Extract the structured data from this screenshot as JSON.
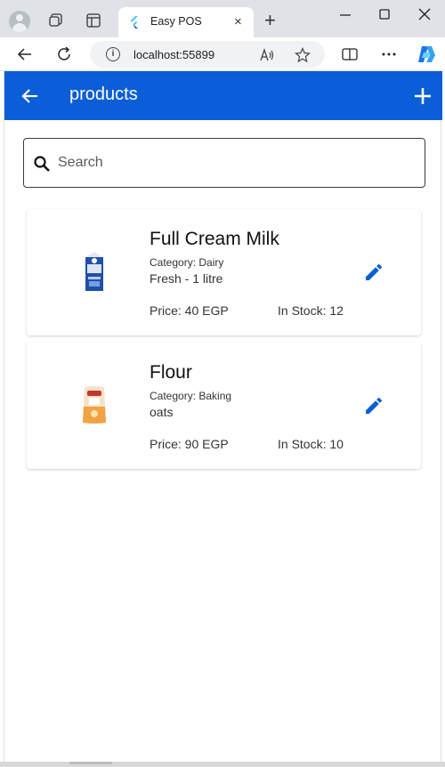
{
  "browser": {
    "tab_title": "Easy POS",
    "tab_close": "×",
    "new_tab": "+",
    "url": "localhost:55899",
    "info_glyph": "i"
  },
  "appbar": {
    "title": "products",
    "back_icon": "arrow-back-icon",
    "add_icon": "add-icon",
    "color": "#0b5ed7"
  },
  "search": {
    "placeholder": "Search",
    "value": ""
  },
  "products": [
    {
      "name": "Full Cream Milk",
      "category": "Category: Dairy",
      "description": "Fresh - 1 litre",
      "price": "Price: 40 EGP",
      "stock": "In Stock: 12",
      "image": "milk-carton-image"
    },
    {
      "name": "Flour",
      "category": "Category: Baking",
      "description": "oats",
      "price": "Price: 90 EGP",
      "stock": "In Stock: 10",
      "image": "flour-bag-image"
    }
  ],
  "colors": {
    "accent": "#0b5ed7",
    "edit_icon": "#0b5ed7"
  }
}
